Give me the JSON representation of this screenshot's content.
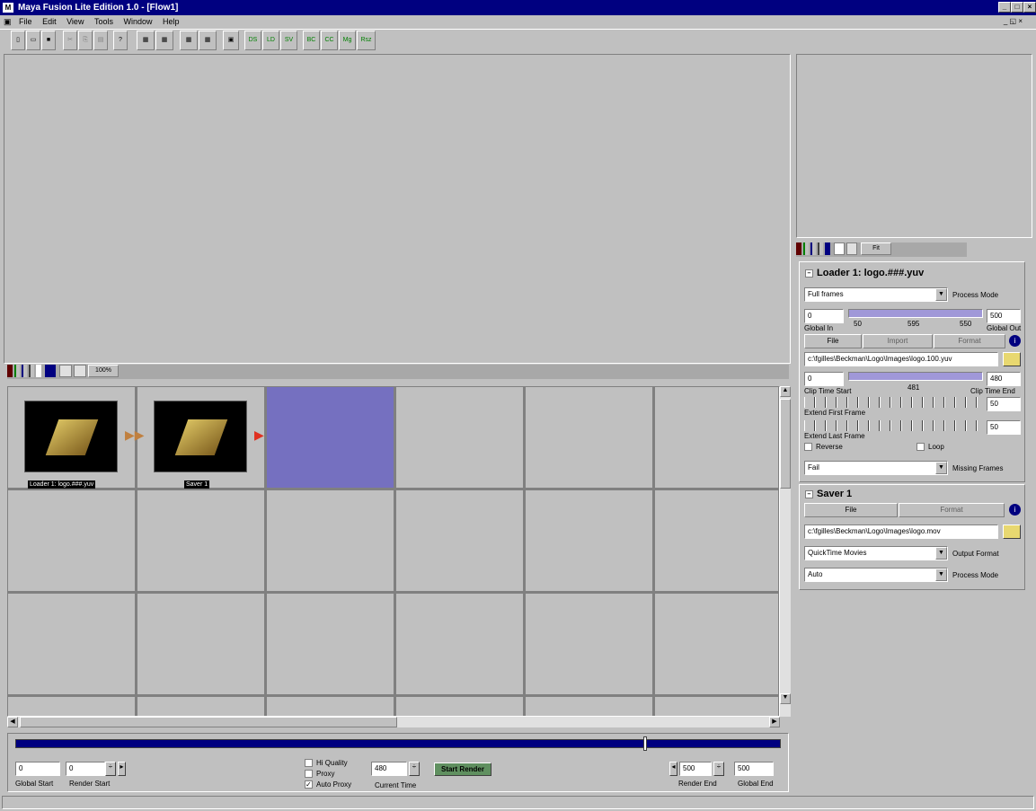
{
  "window": {
    "title": "Maya Fusion Lite Edition 1.0 - [Flow1]"
  },
  "menu": [
    "File",
    "Edit",
    "View",
    "Tools",
    "Window",
    "Help"
  ],
  "toolbar": {
    "text_buttons": [
      "DS",
      "LD",
      "SV",
      "BC",
      "CC",
      "Mg",
      "Rsz"
    ]
  },
  "flow": {
    "zoom": "100%",
    "nodes": [
      {
        "label": "Loader 1: logo.###.yuv"
      },
      {
        "label": "Saver 1"
      }
    ]
  },
  "view_tabs": {
    "fit_label": "Fit"
  },
  "loader": {
    "title": "Loader 1: logo.###.yuv",
    "process_mode_value": "Full frames",
    "process_mode_label": "Process Mode",
    "global_in": "0",
    "global_out": "500",
    "global_in_label": "Global In",
    "global_out_label": "Global Out",
    "range_ticks": [
      "50",
      "595",
      "550"
    ],
    "tabs": [
      "File",
      "Import",
      "Format"
    ],
    "file_path": "c:\\fgilles\\Beckman\\Logo\\Images\\logo.100.yuv",
    "clip_start": "0",
    "clip_end": "480",
    "clip_mid": "481",
    "clip_start_label": "Clip Time Start",
    "clip_end_label": "Clip Time End",
    "extend_first_value": "50",
    "extend_first_label": "Extend First Frame",
    "extend_last_value": "50",
    "extend_last_label": "Extend Last Frame",
    "reverse_label": "Reverse",
    "loop_label": "Loop",
    "missing_frames_value": "Fail",
    "missing_frames_label": "Missing Frames"
  },
  "saver": {
    "title": "Saver 1",
    "tabs": [
      "File",
      "Format"
    ],
    "file_path": "c:\\fgilles\\Beckman\\Logo\\Images\\logo.mov",
    "output_format_value": "QuickTime Movies",
    "output_format_label": "Output Format",
    "process_mode_value": "Auto",
    "process_mode_label": "Process Mode"
  },
  "timeline": {
    "global_start": "0",
    "render_start": "0",
    "global_start_label": "Global Start",
    "render_start_label": "Render Start",
    "hi_quality_label": "Hi Quality",
    "proxy_label": "Proxy",
    "auto_proxy_label": "Auto Proxy",
    "current_time": "480",
    "current_time_label": "Current Time",
    "start_render_label": "Start Render",
    "render_end": "500",
    "global_end": "500",
    "render_end_label": "Render End",
    "global_end_label": "Global End",
    "playhead_fraction": 0.82
  },
  "colors": {
    "accent": "#000080",
    "selection": "#7570c0",
    "link_arrow": "#e03020"
  }
}
